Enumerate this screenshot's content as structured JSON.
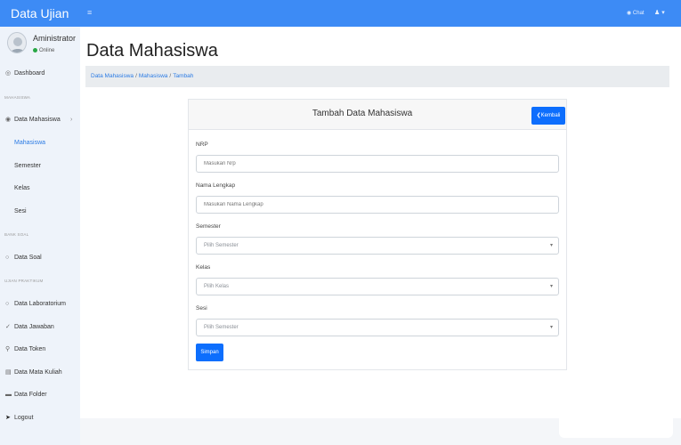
{
  "topbar": {
    "brand": "Data Ujian",
    "menu_icon": "bars-icon",
    "chat_label": "Chat",
    "user_icon": "user-icon"
  },
  "sidebar": {
    "user": {
      "name": "Aministrator",
      "status": "Online"
    },
    "headers": {
      "mahasiswa": "MAHASISWA",
      "bank_soal": "BANK SOAL",
      "ujian": "UJIAN PRAKTIKUM"
    },
    "items": {
      "dashboard": "Dashboard",
      "data_mahasiswa": "Data Mahasiswa",
      "mahasiswa": "Mahasiswa",
      "semester": "Semester",
      "kelas": "Kelas",
      "sesi": "Sesi",
      "data_soal": "Data Soal",
      "data_laboratorium": "Data Laboratorium",
      "data_jawaban": "Data Jawaban",
      "data_token": "Data Token",
      "data_mata_kuliah": "Data Mata Kuliah",
      "data_folder": "Data Folder",
      "logout": "Logout"
    },
    "colors": {
      "active": "#2b7be4"
    }
  },
  "main": {
    "page_title": "Data Mahasiswa",
    "breadcrumb": [
      "Data Mahasiswa",
      "Mahasiswa",
      "Tambah"
    ],
    "card": {
      "title": "Tambah Data Mahasiswa",
      "back_label": "Kembali",
      "fields": {
        "nrp": {
          "label": "NRP",
          "placeholder": "Masukan Nrp"
        },
        "nama": {
          "label": "Nama Lengkap",
          "placeholder": "Masukan Nama Lengkap"
        },
        "semester": {
          "label": "Semester",
          "value": "Pilih Semester"
        },
        "kelas": {
          "label": "Kelas",
          "value": "Pilih Kelas"
        },
        "sesi": {
          "label": "Sesi",
          "value": "Pilih Semester"
        }
      },
      "save_label": "Simpan"
    }
  },
  "colors": {
    "primary": "#0d6efd",
    "topbar": "#3d8bf5"
  }
}
